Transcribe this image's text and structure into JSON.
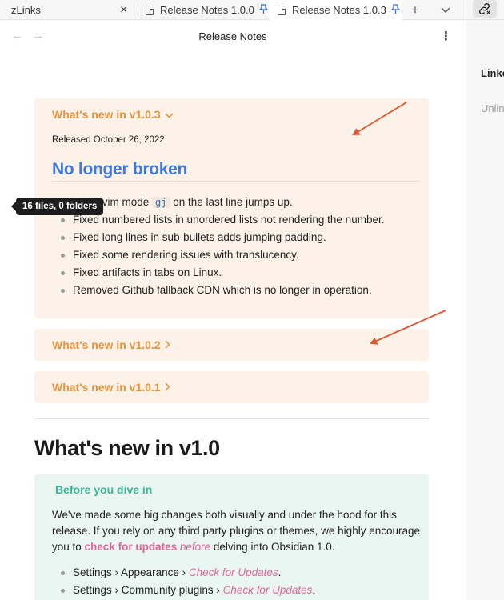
{
  "tabs": [
    {
      "label": "zLinks",
      "active": false
    },
    {
      "label": "Release Notes 1.0.0",
      "active": false,
      "pinned": true
    },
    {
      "label": "Release Notes 1.0.3",
      "active": true,
      "pinned": true
    }
  ],
  "tab_icons": {
    "close": "×",
    "pin": "📌",
    "new_tab": "+",
    "tab_list": "⌄"
  },
  "nav": {
    "back": "←",
    "forward": "→",
    "title": "Release Notes",
    "more": "⋮"
  },
  "right_panel": {
    "link_icon": "🔗",
    "linked_label": "Linked mentions",
    "unlinked_label": "Unlinked mentions"
  },
  "v103": {
    "title": "What's new in v1.0.3",
    "chevron": "⌄",
    "released": "Released October 26, 2022",
    "heading": "No longer broken",
    "first_prefix": "Fixed vim mode",
    "first_code": "gj",
    "first_suffix": "on the last line jumps up.",
    "items": [
      "Fixed numbered lists in unordered lists not rendering the number.",
      "Fixed long lines in sub-bullets adds jumping padding.",
      "Fixed some rendering issues with translucency.",
      "Fixed artifacts in tabs on Linux.",
      "Removed Github fallback CDN which is no longer in operation."
    ]
  },
  "v102": {
    "title": "What's new in v1.0.2",
    "chevron": "›"
  },
  "v101": {
    "title": "What's new in v1.0.1",
    "chevron": "›"
  },
  "tooltip": "16 files, 0 folders",
  "section": {
    "title": "What's new in v1.0",
    "callout_title": "Before you dive in",
    "para_1": "We've made some big changes both visually and under the hood for this release. If you rely on any third party plugins or themes, we highly encourage you to",
    "para_link": "check for updates",
    "para_em": "before",
    "para_2": "delving into Obsidian 1.0.",
    "items": [
      {
        "path": "Settings › Appearance ›",
        "link": "Check for Updates",
        "end": "."
      },
      {
        "path": "Settings › Community plugins ›",
        "link": "Check for Updates",
        "end": "."
      }
    ]
  },
  "colors": {
    "accent_orange": "#e8913a",
    "heading_blue": "#3f79e0",
    "callout_green": "#3ab59a",
    "link_pink": "#e0659a",
    "annotation_arrow": "#e0552f"
  }
}
